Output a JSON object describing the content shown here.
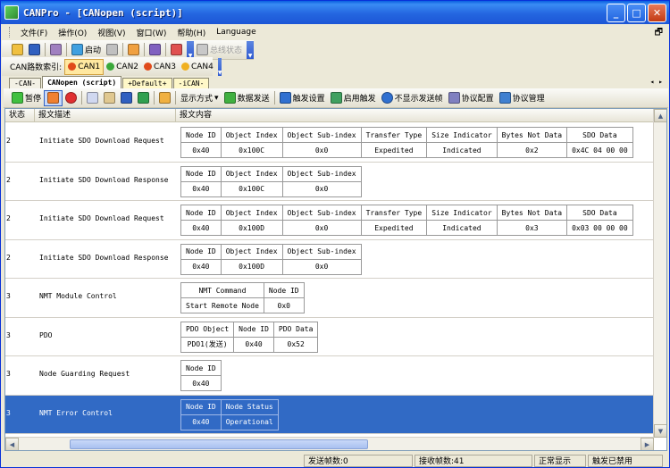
{
  "window": {
    "title": "CANPro - [CANopen (script)]"
  },
  "menu": {
    "items": [
      "文件(F)",
      "操作(O)",
      "视图(V)",
      "窗口(W)",
      "帮助(H)",
      "Language"
    ],
    "restore_glyph": "🗗"
  },
  "toolbar1": {
    "start_label": "启动",
    "bus_state_label": "总线状态"
  },
  "toolbar2": {
    "can_index_label": "CAN路数索引:",
    "channels": [
      "CAN1",
      "CAN2",
      "CAN3",
      "CAN4"
    ],
    "channel_colors": [
      "#e04a1a",
      "#3aa83a",
      "#e04a1a",
      "#f0b020"
    ]
  },
  "tabs": [
    "-CAN-",
    "CANopen (script)",
    "+Default+",
    "-iCAN-"
  ],
  "toolbar3": {
    "pause_label": "暂停",
    "display_mode_label": "显示方式",
    "send_data_label": "数据发送",
    "trigger_settings_label": "触发设置",
    "enable_trigger_label": "启用触发",
    "hide_sent_label": "不显示发送帧",
    "protocol_config_label": "协议配置",
    "protocol_manage_label": "协议管理"
  },
  "columns": [
    "状态",
    "报文描述",
    "报文内容"
  ],
  "rows": [
    {
      "num": "2",
      "desc": "Initiate SDO Download Request",
      "headers": [
        "Node ID",
        "Object Index",
        "Object Sub-index",
        "Transfer Type",
        "Size Indicator",
        "Bytes Not Data",
        "SDO Data"
      ],
      "values": [
        "0x40",
        "0x100C",
        "0x0",
        "Expedited",
        "Indicated",
        "0x2",
        "0x4C 04 00 00"
      ]
    },
    {
      "num": "2",
      "desc": "Initiate SDO Download Response",
      "headers": [
        "Node ID",
        "Object Index",
        "Object Sub-index"
      ],
      "values": [
        "0x40",
        "0x100C",
        "0x0"
      ]
    },
    {
      "num": "2",
      "desc": "Initiate SDO Download Request",
      "headers": [
        "Node ID",
        "Object Index",
        "Object Sub-index",
        "Transfer Type",
        "Size Indicator",
        "Bytes Not Data",
        "SDO Data"
      ],
      "values": [
        "0x40",
        "0x100D",
        "0x0",
        "Expedited",
        "Indicated",
        "0x3",
        "0x03 00 00 00"
      ]
    },
    {
      "num": "2",
      "desc": "Initiate SDO Download Response",
      "headers": [
        "Node ID",
        "Object Index",
        "Object Sub-index"
      ],
      "values": [
        "0x40",
        "0x100D",
        "0x0"
      ]
    },
    {
      "num": "3",
      "desc": "NMT Module Control",
      "headers": [
        "NMT Command",
        "Node ID"
      ],
      "values": [
        "Start Remote Node",
        "0x0"
      ]
    },
    {
      "num": "3",
      "desc": "PDO",
      "headers": [
        "PDO Object",
        "Node ID",
        "PDO Data"
      ],
      "values": [
        "PDO1(发送)",
        "0x40",
        "0x52"
      ]
    },
    {
      "num": "3",
      "desc": "Node Guarding Request",
      "headers": [
        "Node ID"
      ],
      "values": [
        "0x40"
      ]
    },
    {
      "num": "3",
      "desc": "NMT Error Control",
      "headers": [
        "Node ID",
        "Node Status"
      ],
      "values": [
        "0x40",
        "Operational"
      ],
      "selected": true
    }
  ],
  "status": {
    "send_frames": "发送帧数:0",
    "recv_frames": "接收帧数:41",
    "display_mode": "正常显示",
    "trigger_state": "触发已禁用"
  }
}
